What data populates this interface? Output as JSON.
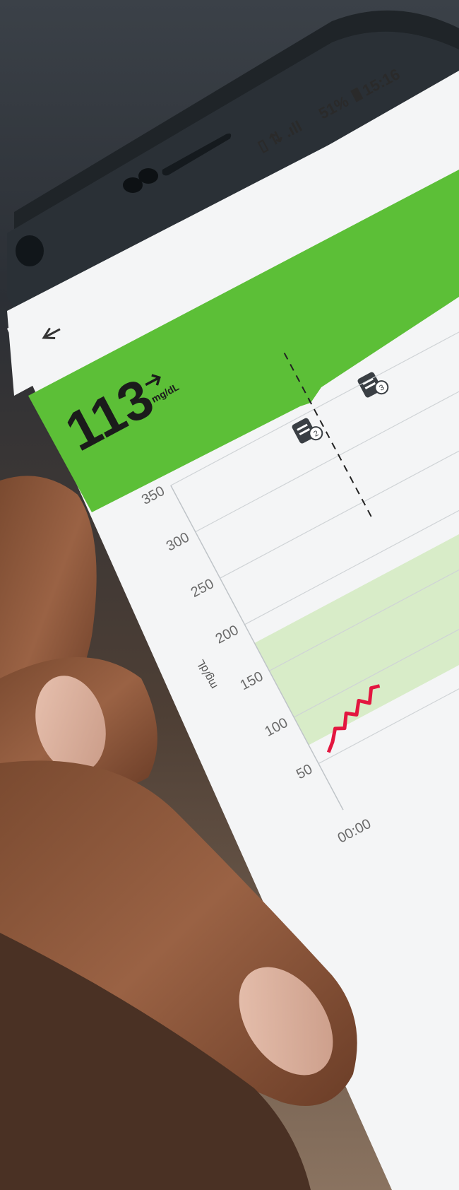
{
  "status_bar": {
    "battery_percent": "51%",
    "time": "15:16"
  },
  "header": {
    "back_icon": "arrow-left-icon",
    "glucose_value": "113",
    "trend_icon": "arrow-right-icon",
    "unit": "mg/dL",
    "header_color": "#5cbf37"
  },
  "notes": [
    {
      "icon": "note-icon",
      "count": "2"
    },
    {
      "icon": "note-icon",
      "count": "3"
    }
  ],
  "chart_data": {
    "type": "line",
    "ylabel": "mg/dL",
    "yticks": [
      350,
      300,
      250,
      200,
      150,
      100,
      50
    ],
    "xticks": [
      "00:00"
    ],
    "target_range": [
      70,
      180
    ],
    "target_range_color": "#d8ecc8",
    "line_color": "#e3163f",
    "series": [
      {
        "values": [
          55,
          62,
          72,
          68,
          80,
          74,
          85,
          78,
          90,
          88
        ]
      }
    ]
  }
}
